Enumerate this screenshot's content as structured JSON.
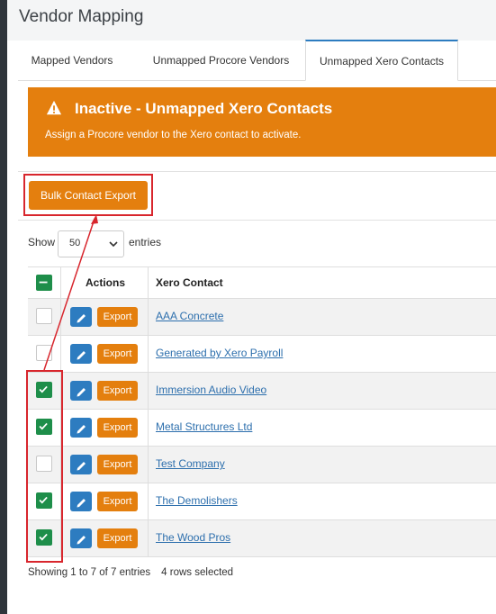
{
  "page": {
    "title": "Vendor Mapping"
  },
  "tabs": [
    {
      "label": "Mapped Vendors",
      "active": false
    },
    {
      "label": "Unmapped Procore Vendors",
      "active": false
    },
    {
      "label": "Unmapped Xero Contacts",
      "active": true
    }
  ],
  "alert": {
    "icon": "warning-icon",
    "title": "Inactive - Unmapped Xero Contacts",
    "text": "Assign a Procore vendor to the Xero contact to activate.",
    "color": "#e47f0e"
  },
  "toolbar": {
    "bulk_export_label": "Bulk Contact Export"
  },
  "length_menu": {
    "show_label": "Show",
    "selected": "50",
    "entries_label": "entries"
  },
  "table": {
    "headers": {
      "actions": "Actions",
      "contact": "Xero Contact"
    },
    "export_label": "Export",
    "rows": [
      {
        "contact": "AAA Concrete",
        "checked": false
      },
      {
        "contact": "Generated by Xero Payroll",
        "checked": false
      },
      {
        "contact": "Immersion Audio Video",
        "checked": true
      },
      {
        "contact": "Metal Structures Ltd",
        "checked": true
      },
      {
        "contact": "Test Company",
        "checked": false
      },
      {
        "contact": "The Demolishers",
        "checked": true
      },
      {
        "contact": "The Wood Pros",
        "checked": true
      }
    ]
  },
  "footer": {
    "info": "Showing 1 to 7 of 7 entries",
    "selected": "4 rows selected"
  },
  "colors": {
    "accent_orange": "#e47f0e",
    "edit_blue": "#2d7cc0",
    "check_green": "#1e8e4a",
    "highlight_red": "#d8262d"
  }
}
